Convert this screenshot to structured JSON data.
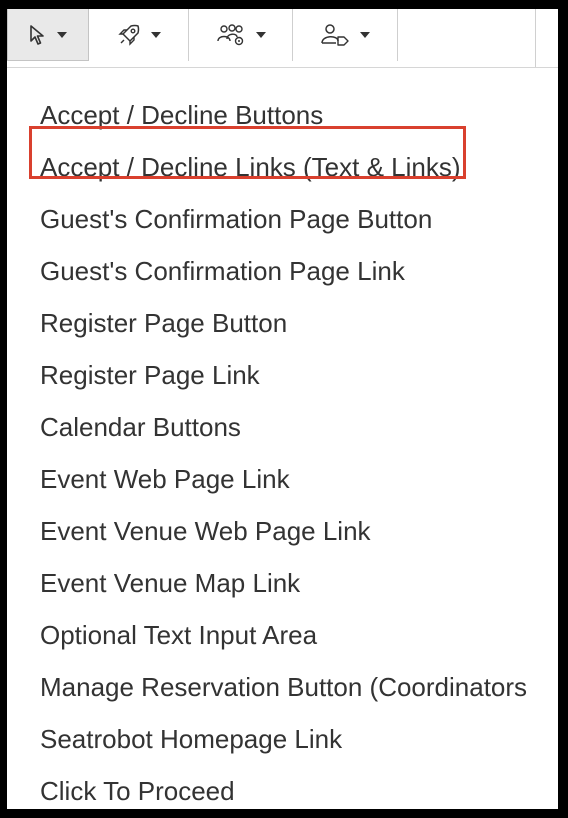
{
  "toolbar": {
    "buttons": [
      {
        "icon": "cursor-arrow-icon"
      },
      {
        "icon": "rocket-icon"
      },
      {
        "icon": "people-settings-icon"
      },
      {
        "icon": "person-tag-icon"
      }
    ]
  },
  "menu": {
    "items": [
      "Accept / Decline Buttons",
      "Accept / Decline Links (Text & Links)",
      "Guest's Confirmation Page Button",
      "Guest's Confirmation Page Link",
      "Register Page Button",
      "Register Page Link",
      "Calendar Buttons",
      "Event Web Page Link",
      "Event Venue Web Page Link",
      "Event Venue Map Link",
      "Optional Text Input Area",
      "Manage Reservation Button (Coordinators",
      "Seatrobot Homepage Link",
      "Click To Proceed"
    ],
    "highlighted_index": 2,
    "highlight_color": "#d9402e"
  }
}
